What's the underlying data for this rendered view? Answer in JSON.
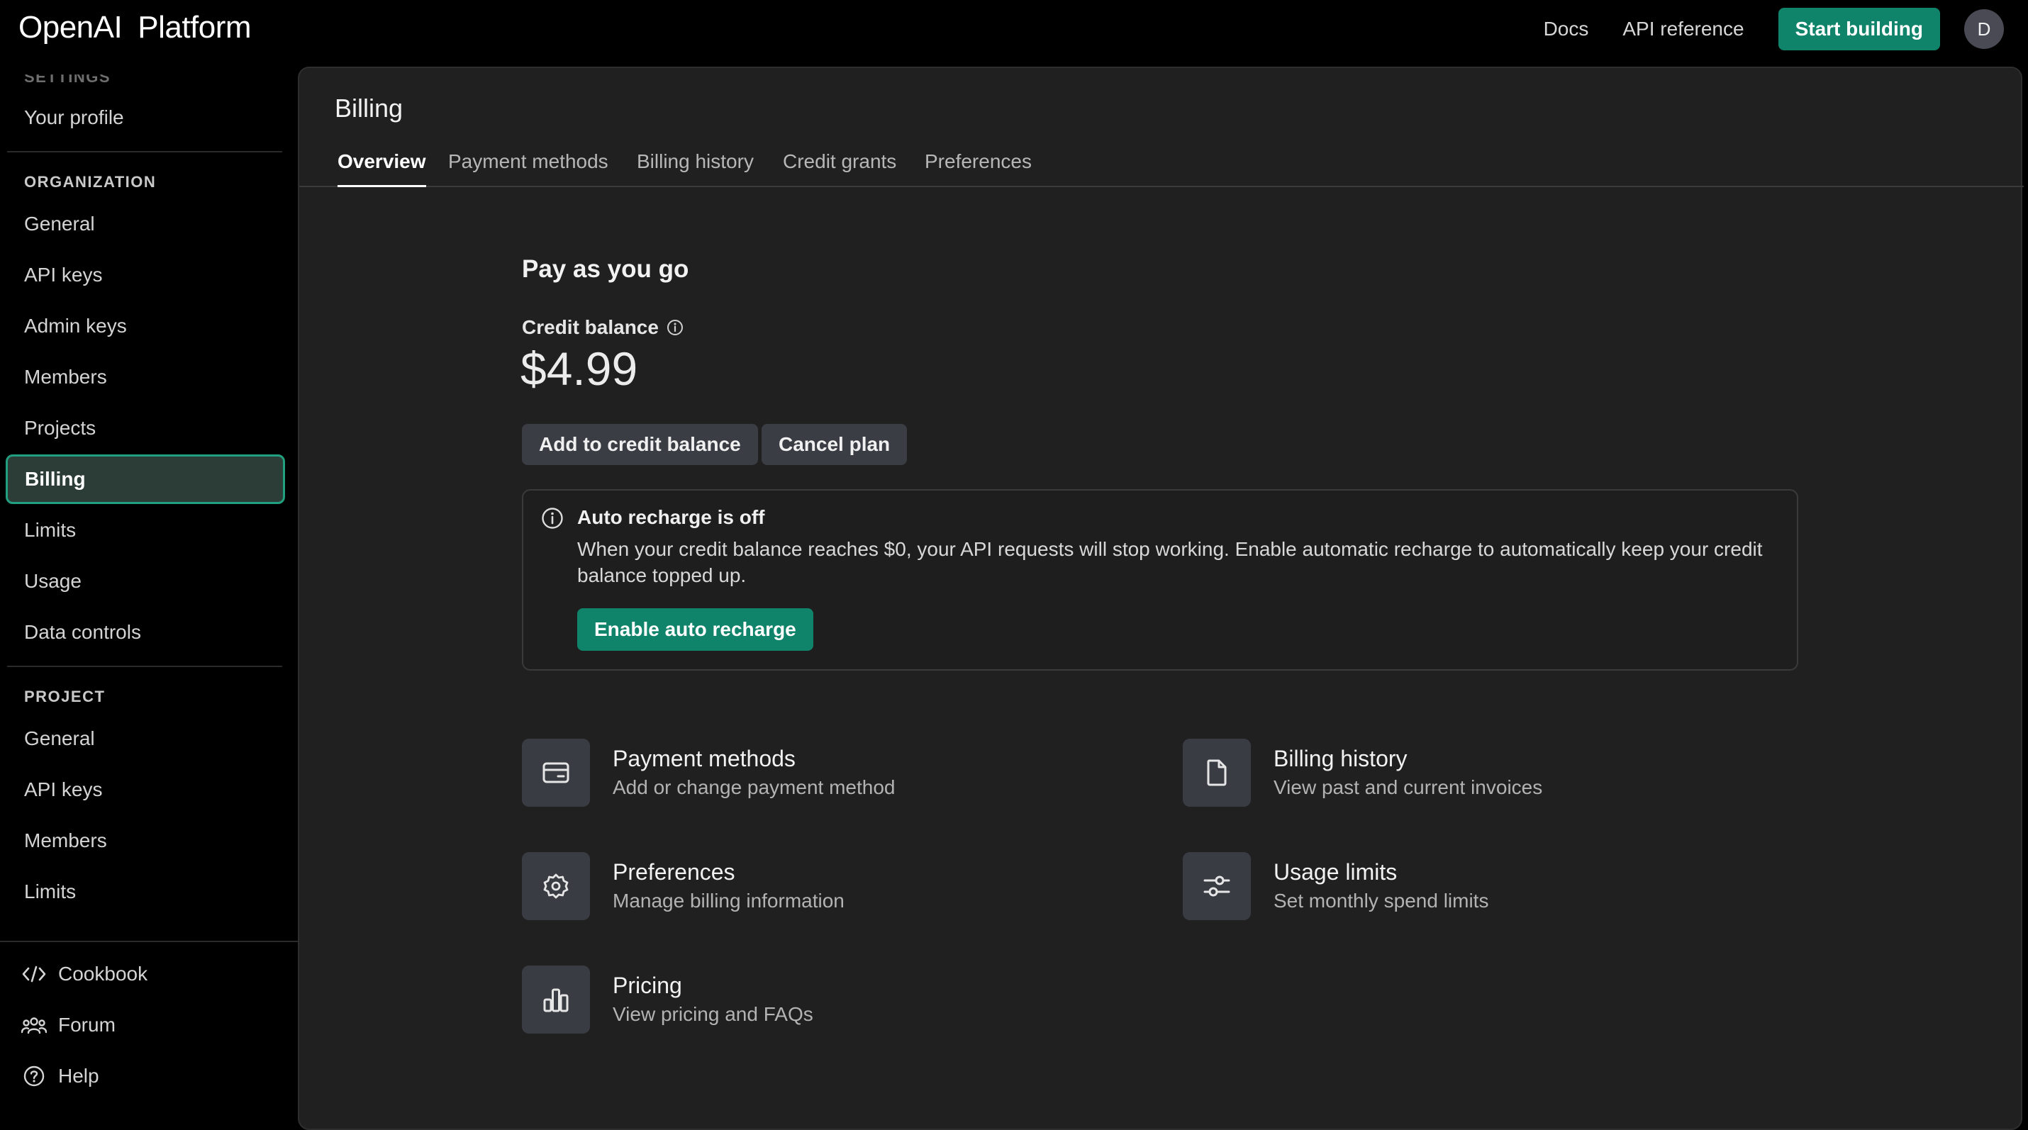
{
  "header": {
    "logo_primary": "OpenAI",
    "logo_secondary": "Platform",
    "docs_link": "Docs",
    "api_reference_link": "API reference",
    "start_building": "Start building",
    "avatar_initial": "D"
  },
  "sidebar": {
    "settings_heading": "SETTINGS",
    "your_profile": "Your profile",
    "organization_heading": "ORGANIZATION",
    "organization_items": [
      "General",
      "API keys",
      "Admin keys",
      "Members",
      "Projects",
      "Billing",
      "Limits",
      "Usage",
      "Data controls"
    ],
    "active_item": "Billing",
    "project_heading": "PROJECT",
    "project_items": [
      "General",
      "API keys",
      "Members",
      "Limits"
    ],
    "footer_items": [
      {
        "label": "Cookbook",
        "icon": "code-icon"
      },
      {
        "label": "Forum",
        "icon": "people-icon"
      },
      {
        "label": "Help",
        "icon": "help-circle-icon"
      }
    ]
  },
  "main": {
    "title": "Billing",
    "tabs": [
      "Overview",
      "Payment methods",
      "Billing history",
      "Credit grants",
      "Preferences"
    ],
    "active_tab": "Overview",
    "plan_title": "Pay as you go",
    "credit_label": "Credit balance",
    "credit_value": "$4.99",
    "add_credit_button": "Add to credit balance",
    "cancel_plan_button": "Cancel plan",
    "notice": {
      "title": "Auto recharge is off",
      "body": "When your credit balance reaches $0, your API requests will stop working. Enable automatic recharge to automatically keep your credit balance topped up.",
      "button": "Enable auto recharge"
    },
    "links": [
      {
        "title": "Payment methods",
        "subtitle": "Add or change payment method",
        "icon": "credit-card-icon"
      },
      {
        "title": "Billing history",
        "subtitle": "View past and current invoices",
        "icon": "document-icon"
      },
      {
        "title": "Preferences",
        "subtitle": "Manage billing information",
        "icon": "gear-icon"
      },
      {
        "title": "Usage limits",
        "subtitle": "Set monthly spend limits",
        "icon": "sliders-icon"
      },
      {
        "title": "Pricing",
        "subtitle": "View pricing and FAQs",
        "icon": "bar-chart-icon"
      }
    ]
  },
  "colors": {
    "accent_green": "#10846a",
    "active_border": "#21a07f",
    "panel_bg": "#202020",
    "page_bg": "#000000"
  }
}
